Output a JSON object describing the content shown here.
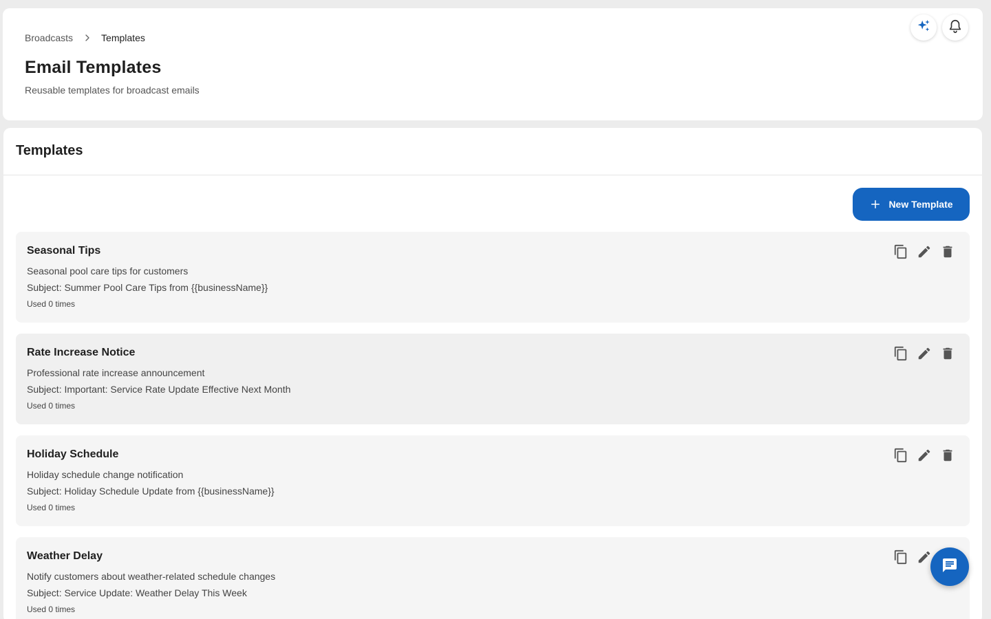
{
  "header": {
    "breadcrumb": {
      "parent": "Broadcasts",
      "current": "Templates"
    },
    "title": "Email Templates",
    "subtitle": "Reusable templates for broadcast emails",
    "icons": {
      "ai": "sparkle-icon",
      "notifications": "bell-icon"
    }
  },
  "main": {
    "section_title": "Templates",
    "new_template_label": "New Template",
    "templates": [
      {
        "name": "Seasonal Tips",
        "description": "Seasonal pool care tips for customers",
        "subject": "Subject: Summer Pool Care Tips from {{businessName}}",
        "used": "Used 0 times"
      },
      {
        "name": "Rate Increase Notice",
        "description": "Professional rate increase announcement",
        "subject": "Subject: Important: Service Rate Update Effective Next Month",
        "used": "Used 0 times"
      },
      {
        "name": "Holiday Schedule",
        "description": "Holiday schedule change notification",
        "subject": "Subject: Holiday Schedule Update from {{businessName}}",
        "used": "Used 0 times"
      },
      {
        "name": "Weather Delay",
        "description": "Notify customers about weather-related schedule changes",
        "subject": "Subject: Service Update: Weather Delay This Week",
        "used": "Used 0 times"
      }
    ]
  },
  "colors": {
    "primary": "#1565c0",
    "page_bg": "#ececec",
    "card_bg": "#f5f5f5",
    "icon_gray": "#555555"
  },
  "fab_icon": "chat-icon"
}
